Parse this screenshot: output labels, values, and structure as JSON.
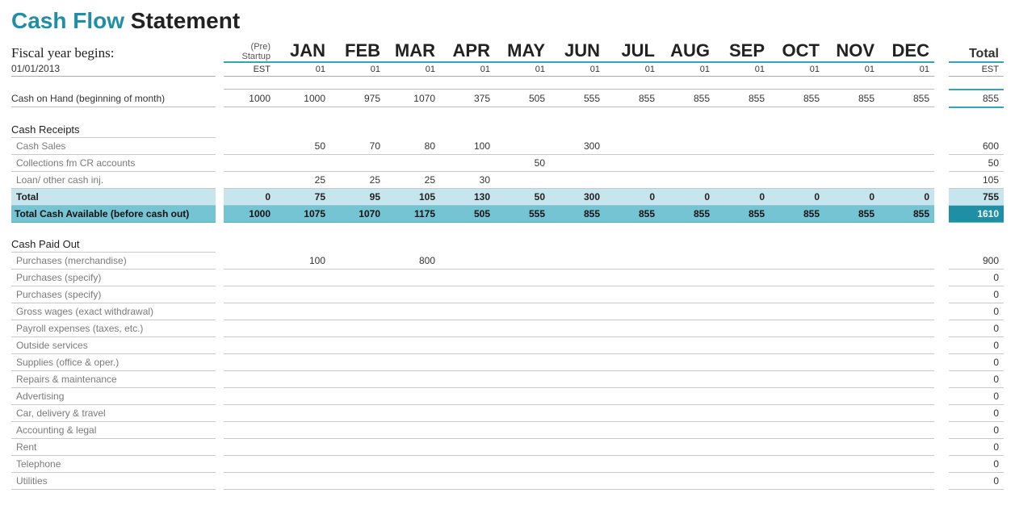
{
  "title": {
    "first": "Cash Flow",
    "second": " Statement"
  },
  "fiscal_label": "Fiscal year begins:",
  "fiscal_date": "01/01/2013",
  "pre_header": {
    "line1": "(Pre)",
    "line2": "Startup",
    "line3": "EST"
  },
  "months": [
    "JAN",
    "FEB",
    "MAR",
    "APR",
    "MAY",
    "JUN",
    "JUL",
    "AUG",
    "SEP",
    "OCT",
    "NOV",
    "DEC"
  ],
  "month_sub": [
    "01",
    "01",
    "01",
    "01",
    "01",
    "01",
    "01",
    "01",
    "01",
    "01",
    "01",
    "01"
  ],
  "total_header": "Total",
  "total_sub": "EST",
  "coh": {
    "label": "Cash on Hand (beginning of month)",
    "pre": "1000",
    "vals": [
      "1000",
      "975",
      "1070",
      "375",
      "505",
      "555",
      "855",
      "855",
      "855",
      "855",
      "855",
      "855"
    ],
    "total": "855"
  },
  "receipts_header": "Cash Receipts",
  "receipts": [
    {
      "label": "Cash Sales",
      "pre": "",
      "vals": [
        "50",
        "70",
        "80",
        "100",
        "",
        "300",
        "",
        "",
        "",
        "",
        "",
        ""
      ],
      "total": "600"
    },
    {
      "label": "Collections fm CR accounts",
      "pre": "",
      "vals": [
        "",
        "",
        "",
        "",
        "50",
        "",
        "",
        "",
        "",
        "",
        "",
        ""
      ],
      "total": "50"
    },
    {
      "label": "Loan/ other cash inj.",
      "pre": "",
      "vals": [
        "25",
        "25",
        "25",
        "30",
        "",
        "",
        "",
        "",
        "",
        "",
        "",
        ""
      ],
      "total": "105"
    }
  ],
  "receipts_total": {
    "label": "Total",
    "pre": "0",
    "vals": [
      "75",
      "95",
      "105",
      "130",
      "50",
      "300",
      "0",
      "0",
      "0",
      "0",
      "0",
      "0"
    ],
    "total": "755"
  },
  "cash_avail": {
    "label": "Total Cash Available (before cash out)",
    "pre": "1000",
    "vals": [
      "1075",
      "1070",
      "1175",
      "505",
      "555",
      "855",
      "855",
      "855",
      "855",
      "855",
      "855",
      "855"
    ],
    "total": "1610"
  },
  "paidout_header": "Cash Paid Out",
  "paidout": [
    {
      "label": "Purchases (merchandise)",
      "pre": "",
      "vals": [
        "100",
        "",
        "800",
        "",
        "",
        "",
        "",
        "",
        "",
        "",
        "",
        ""
      ],
      "total": "900"
    },
    {
      "label": "Purchases (specify)",
      "pre": "",
      "vals": [
        "",
        "",
        "",
        "",
        "",
        "",
        "",
        "",
        "",
        "",
        "",
        ""
      ],
      "total": "0"
    },
    {
      "label": "Purchases (specify)",
      "pre": "",
      "vals": [
        "",
        "",
        "",
        "",
        "",
        "",
        "",
        "",
        "",
        "",
        "",
        ""
      ],
      "total": "0"
    },
    {
      "label": "Gross wages (exact withdrawal)",
      "pre": "",
      "vals": [
        "",
        "",
        "",
        "",
        "",
        "",
        "",
        "",
        "",
        "",
        "",
        ""
      ],
      "total": "0"
    },
    {
      "label": "Payroll expenses (taxes, etc.)",
      "pre": "",
      "vals": [
        "",
        "",
        "",
        "",
        "",
        "",
        "",
        "",
        "",
        "",
        "",
        ""
      ],
      "total": "0"
    },
    {
      "label": "Outside services",
      "pre": "",
      "vals": [
        "",
        "",
        "",
        "",
        "",
        "",
        "",
        "",
        "",
        "",
        "",
        ""
      ],
      "total": "0"
    },
    {
      "label": "Supplies (office & oper.)",
      "pre": "",
      "vals": [
        "",
        "",
        "",
        "",
        "",
        "",
        "",
        "",
        "",
        "",
        "",
        ""
      ],
      "total": "0"
    },
    {
      "label": "Repairs & maintenance",
      "pre": "",
      "vals": [
        "",
        "",
        "",
        "",
        "",
        "",
        "",
        "",
        "",
        "",
        "",
        ""
      ],
      "total": "0"
    },
    {
      "label": "Advertising",
      "pre": "",
      "vals": [
        "",
        "",
        "",
        "",
        "",
        "",
        "",
        "",
        "",
        "",
        "",
        ""
      ],
      "total": "0"
    },
    {
      "label": "Car, delivery & travel",
      "pre": "",
      "vals": [
        "",
        "",
        "",
        "",
        "",
        "",
        "",
        "",
        "",
        "",
        "",
        ""
      ],
      "total": "0"
    },
    {
      "label": "Accounting & legal",
      "pre": "",
      "vals": [
        "",
        "",
        "",
        "",
        "",
        "",
        "",
        "",
        "",
        "",
        "",
        ""
      ],
      "total": "0"
    },
    {
      "label": "Rent",
      "pre": "",
      "vals": [
        "",
        "",
        "",
        "",
        "",
        "",
        "",
        "",
        "",
        "",
        "",
        ""
      ],
      "total": "0"
    },
    {
      "label": "Telephone",
      "pre": "",
      "vals": [
        "",
        "",
        "",
        "",
        "",
        "",
        "",
        "",
        "",
        "",
        "",
        ""
      ],
      "total": "0"
    },
    {
      "label": "Utilities",
      "pre": "",
      "vals": [
        "",
        "",
        "",
        "",
        "",
        "",
        "",
        "",
        "",
        "",
        "",
        ""
      ],
      "total": "0"
    }
  ]
}
